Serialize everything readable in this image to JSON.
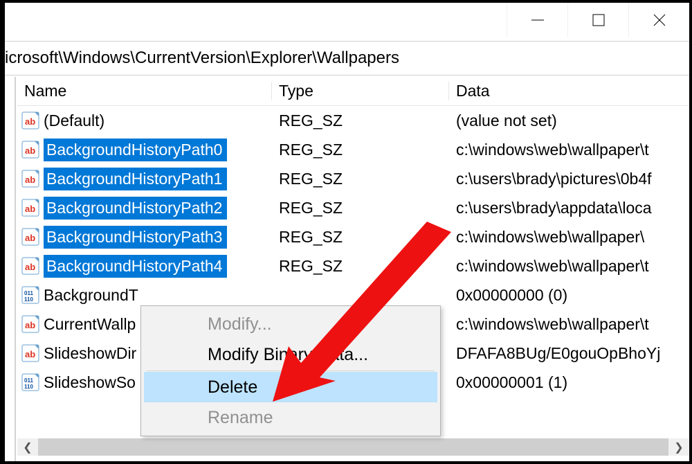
{
  "address": "icrosoft\\Windows\\CurrentVersion\\Explorer\\Wallpapers",
  "columns": {
    "name": "Name",
    "type": "Type",
    "data": "Data"
  },
  "rows": [
    {
      "icon": "str",
      "name": "(Default)",
      "type": "REG_SZ",
      "data": "(value not set)",
      "sel": false
    },
    {
      "icon": "str",
      "name": "BackgroundHistoryPath0",
      "type": "REG_SZ",
      "data": "c:\\windows\\web\\wallpaper\\t",
      "sel": true
    },
    {
      "icon": "str",
      "name": "BackgroundHistoryPath1",
      "type": "REG_SZ",
      "data": "c:\\users\\brady\\pictures\\0b4f",
      "sel": true
    },
    {
      "icon": "str",
      "name": "BackgroundHistoryPath2",
      "type": "REG_SZ",
      "data": "c:\\users\\brady\\appdata\\loca",
      "sel": true
    },
    {
      "icon": "str",
      "name": "BackgroundHistoryPath3",
      "type": "REG_SZ",
      "data": "c:\\windows\\web\\wallpaper\\",
      "sel": true
    },
    {
      "icon": "str",
      "name": "BackgroundHistoryPath4",
      "type": "REG_SZ",
      "data": "c:\\windows\\web\\wallpaper\\t",
      "sel": true
    },
    {
      "icon": "bin",
      "name": "BackgroundT",
      "type": "",
      "data": "0x00000000 (0)",
      "sel": false
    },
    {
      "icon": "str",
      "name": "CurrentWallp",
      "type": "",
      "data": "c:\\windows\\web\\wallpaper\\t",
      "sel": false
    },
    {
      "icon": "str",
      "name": "SlideshowDir",
      "type": "",
      "data": "DFAFA8BUg/E0gouOpBhoYj",
      "sel": false
    },
    {
      "icon": "bin",
      "name": "SlideshowSo",
      "type": "",
      "data": "0x00000001 (1)",
      "sel": false
    }
  ],
  "context": {
    "modify": "Modify...",
    "modifyBinary": "Modify Binary Data...",
    "delete": "Delete",
    "rename": "Rename"
  }
}
